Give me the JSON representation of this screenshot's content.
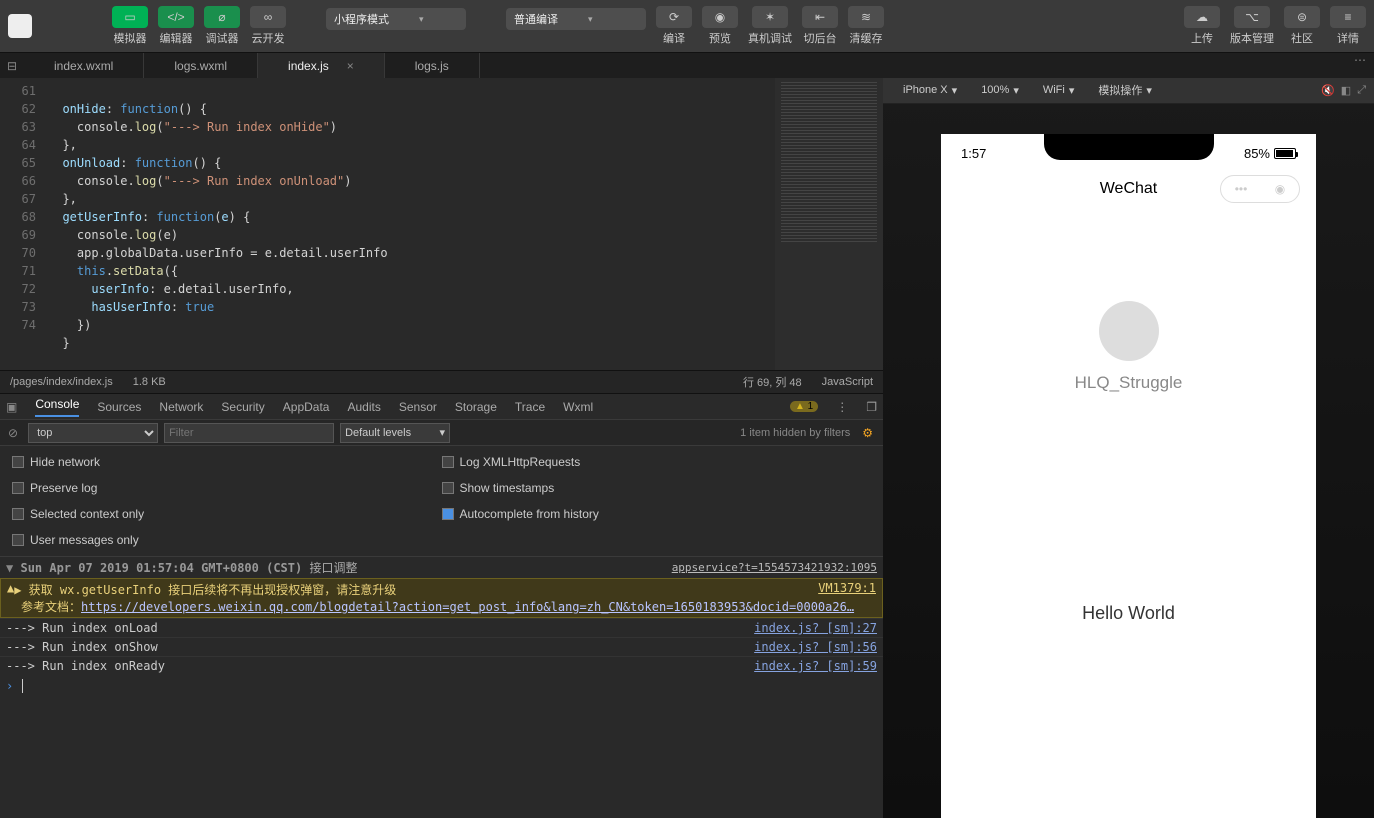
{
  "toolbar": {
    "mode_dd": "小程序模式",
    "compile_dd": "普通编译",
    "buttons": [
      "模拟器",
      "编辑器",
      "调试器",
      "云开发"
    ],
    "right": [
      "编译",
      "预览",
      "真机调试",
      "切后台",
      "清缓存"
    ],
    "far": [
      "上传",
      "版本管理",
      "社区",
      "详情"
    ]
  },
  "filetabs": [
    "index.wxml",
    "logs.wxml",
    "index.js",
    "logs.js"
  ],
  "active_tab": 2,
  "code": {
    "lines": [
      {
        "n": 61,
        "t": "  onHide: function() {"
      },
      {
        "n": 62,
        "t": "    console.log(\"---> Run index onHide\")"
      },
      {
        "n": 63,
        "t": "  },"
      },
      {
        "n": 64,
        "t": "  onUnload: function() {"
      },
      {
        "n": 65,
        "t": "    console.log(\"---> Run index onUnload\")"
      },
      {
        "n": 66,
        "t": "  },"
      },
      {
        "n": 67,
        "t": "  getUserInfo: function(e) {"
      },
      {
        "n": 68,
        "t": "    console.log(e)"
      },
      {
        "n": 69,
        "t": "    app.globalData.userInfo = e.detail.userInfo"
      },
      {
        "n": 70,
        "t": "    this.setData({"
      },
      {
        "n": 71,
        "t": "      userInfo: e.detail.userInfo,"
      },
      {
        "n": 72,
        "t": "      hasUserInfo: true"
      },
      {
        "n": 73,
        "t": "    })"
      },
      {
        "n": 74,
        "t": "  }"
      }
    ]
  },
  "editorbar": {
    "path": "/pages/index/index.js",
    "size": "1.8 KB",
    "pos": "行 69,  列 48",
    "lang": "JavaScript"
  },
  "devtabs": [
    "Console",
    "Sources",
    "Network",
    "Security",
    "AppData",
    "Audits",
    "Sensor",
    "Storage",
    "Trace",
    "Wxml"
  ],
  "devtab_active": 0,
  "warn_count": "1",
  "filter": {
    "context": "top",
    "placeholder": "Filter",
    "levels": "Default levels",
    "hidden": "1 item hidden by filters"
  },
  "opts": {
    "left": [
      "Hide network",
      "Preserve log",
      "Selected context only",
      "User messages only"
    ],
    "right": [
      "Log XMLHttpRequests",
      "Show timestamps",
      "Autocomplete from history"
    ]
  },
  "console": {
    "group": {
      "ts": "Sun Apr 07 2019 01:57:04 GMT+0800 (CST)",
      "lbl": "接口调整",
      "link": "appservice?t=1554573421932:1095"
    },
    "warn": {
      "l1": "▶ 获取 wx.getUserInfo 接口后续将不再出现授权弹窗，请注意升级",
      "vm": "VM1379:1",
      "l2": "参考文档：",
      "url": "https://developers.weixin.qq.com/blogdetail?action=get_post_info&lang=zh_CN&token=1650183953&docid=0000a26…"
    },
    "logs": [
      {
        "t": "---> Run index onLoad",
        "s": "index.js? [sm]:27"
      },
      {
        "t": "---> Run index onShow",
        "s": "index.js? [sm]:56"
      },
      {
        "t": "---> Run index onReady",
        "s": "index.js? [sm]:59"
      }
    ]
  },
  "sim": {
    "device": "iPhone X",
    "zoom": "100%",
    "net": "WiFi",
    "action": "模拟操作",
    "time": "1:57",
    "battery": "85%",
    "header": "WeChat",
    "user": "HLQ_Struggle",
    "hello": "Hello World"
  }
}
